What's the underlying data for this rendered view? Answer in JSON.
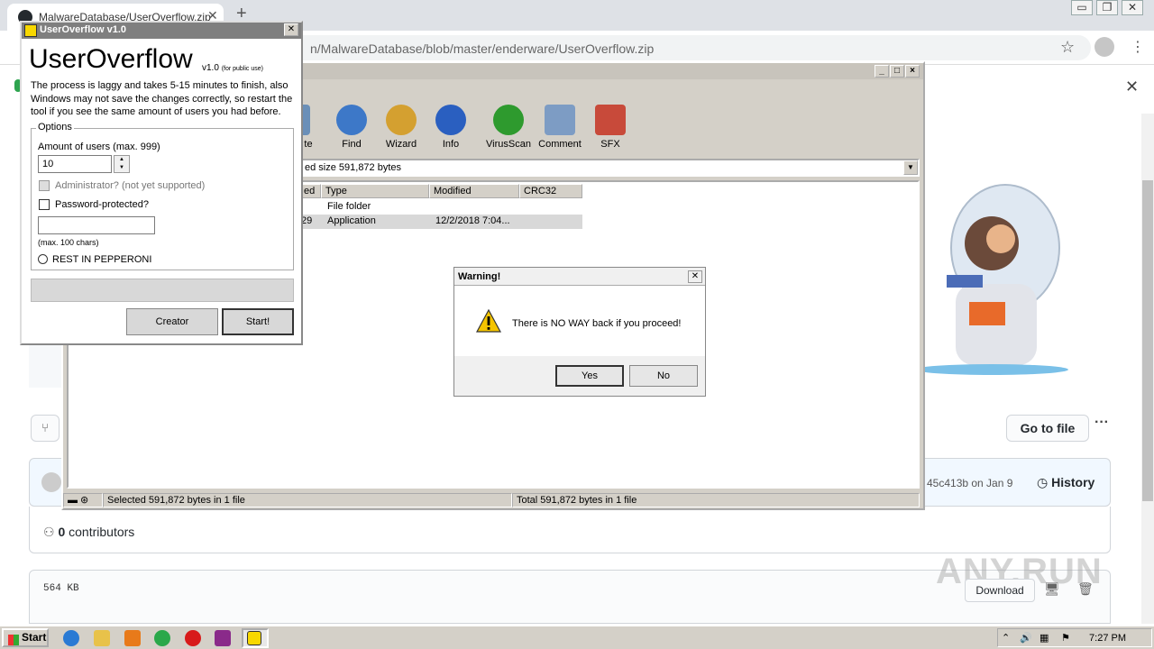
{
  "browser": {
    "tab_title": "MalwareDatabase/UserOverflow.zip",
    "tab_close": "✕",
    "new_tab": "+",
    "url": "n/MalwareDatabase/blob/master/enderware/UserOverflow.zip",
    "window_controls": [
      "▭",
      "❐",
      "✕"
    ],
    "star": "☆",
    "menu": "⋮",
    "banner_close": "✕"
  },
  "github": {
    "goto_file": "Go to file",
    "more": "···",
    "branch_icon": "⑂",
    "commit_hash": "45c413b on Jan 9",
    "history": "History",
    "history_icon": "◷",
    "contributors_count": "0",
    "contributors_label": "contributors",
    "file_size": "564 KB",
    "download": "Download",
    "watermark": "ANY.RUN"
  },
  "winrar": {
    "title_controls": [
      "_",
      "□",
      "×"
    ],
    "tools": [
      {
        "label": "te",
        "color": "#6a8fb8"
      },
      {
        "label": "Find",
        "color": "#3d78c8"
      },
      {
        "label": "Wizard",
        "color": "#d4a030"
      },
      {
        "label": "Info",
        "color": "#2a5fc0"
      },
      {
        "label": "VirusScan",
        "color": "#2e9a2e"
      },
      {
        "label": "Comment",
        "color": "#7d9cc4"
      },
      {
        "label": "SFX",
        "color": "#c84a3a"
      }
    ],
    "path_text": "ed size 591,872 bytes",
    "columns": [
      "ed",
      "Type",
      "Modified",
      "CRC32"
    ],
    "rows": [
      {
        "size": "",
        "type": "File folder",
        "modified": "",
        "crc": ""
      },
      {
        "size": "29",
        "type": "Application",
        "modified": "12/2/2018 7:04...",
        "crc": ""
      }
    ],
    "status_left": "Selected 591,872 bytes in 1 file",
    "status_right": "Total 591,872 bytes in 1 file"
  },
  "useroverflow": {
    "title": "UserOverflow v1.0",
    "close": "✕",
    "heading": "UserOverflow",
    "version": "v1.0",
    "version_note": "(for public use)",
    "description": "The process is laggy and takes 5-15 minutes to finish, also Windows may not save the changes correctly, so restart the tool if you see the same amount of users you had before.",
    "options_legend": "Options",
    "amount_label": "Amount of users (max. 999)",
    "amount_value": "10",
    "admin_label": "Administrator? (not yet supported)",
    "password_label": "Password-protected?",
    "password_value": "",
    "max_chars": "(max. 100 chars)",
    "rest_label": "REST IN PEPPERONI",
    "creator_button": "Creator",
    "start_button": "Start!"
  },
  "warning": {
    "title": "Warning!",
    "close": "✕",
    "message": "There is NO WAY back if you proceed!",
    "yes": "Yes",
    "no": "No"
  },
  "taskbar": {
    "start": "Start",
    "clock": "7:27 PM",
    "icons": [
      {
        "name": "ie",
        "color": "#2a7ad4"
      },
      {
        "name": "explorer",
        "color": "#e8c24a"
      },
      {
        "name": "media",
        "color": "#e87a1a"
      },
      {
        "name": "chrome",
        "color": "#2aa84a"
      },
      {
        "name": "opera",
        "color": "#d81a1a"
      },
      {
        "name": "winrar",
        "color": "#8a2a8a"
      }
    ]
  }
}
